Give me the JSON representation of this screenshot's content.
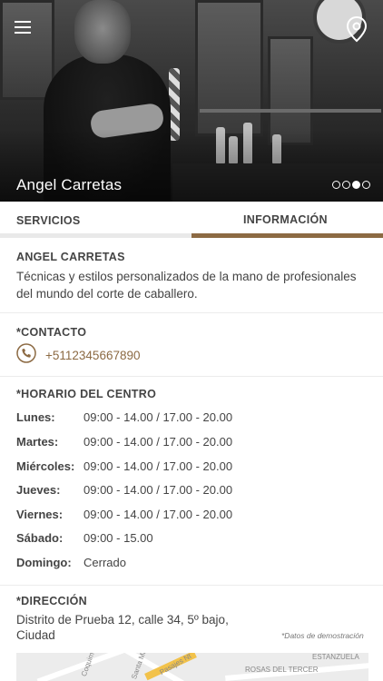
{
  "hero": {
    "title": "Angel Carretas",
    "slides_total": 4,
    "slide_active": 3
  },
  "tabs": [
    {
      "label": "SERVICIOS",
      "active": false
    },
    {
      "label": "INFORMACIÓN",
      "active": true
    }
  ],
  "about": {
    "title": "ANGEL CARRETAS",
    "text": "Técnicas y estilos personalizados de la mano de profesionales del mundo del corte de caballero."
  },
  "contact": {
    "title": "*CONTACTO",
    "phone": "+5112345667890",
    "icon": "phone-icon"
  },
  "schedule": {
    "title": "*HORARIO DEL CENTRO",
    "rows": [
      {
        "day": "Lunes:",
        "hours": "09:00 - 14.00  /  17.00 - 20.00"
      },
      {
        "day": "Martes:",
        "hours": "09:00 - 14.00  /  17.00 - 20.00"
      },
      {
        "day": "Miércoles:",
        "hours": "09:00 - 14.00  /  17.00 - 20.00"
      },
      {
        "day": "Jueves:",
        "hours": "09:00 - 14.00  /  17.00 - 20.00"
      },
      {
        "day": "Viernes:",
        "hours": "09:00 - 14.00  /  17.00 - 20.00"
      },
      {
        "day": "Sábado:",
        "hours": "09:00 - 15.00"
      },
      {
        "day": "Domingo:",
        "hours": "Cerrado"
      }
    ]
  },
  "address": {
    "title": "*DIRECCIÓN",
    "text": "Distrito de Prueba 12, calle 34, 5º bajo, Ciudad",
    "demo_note": "*Datos de demostración"
  },
  "map": {
    "labels": [
      "Coquimbo",
      "Santa Ma",
      "Pasajes Nt",
      "ROSAS DEL TERCER",
      "ESTANZUELA"
    ]
  },
  "colors": {
    "accent": "#8c6a43",
    "text": "#444444",
    "tab_inactive": "#e9e9e9"
  }
}
